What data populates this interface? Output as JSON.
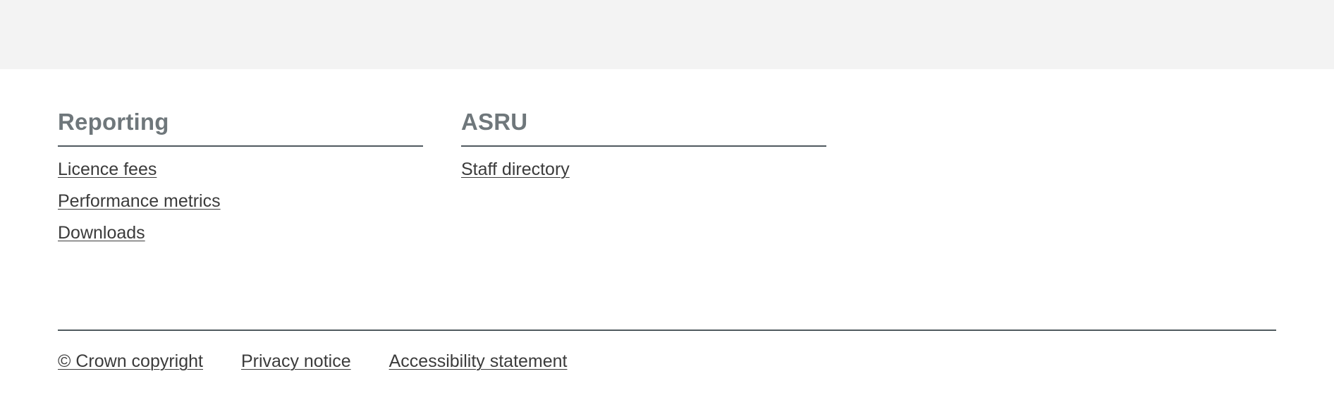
{
  "footer": {
    "columns": [
      {
        "heading": "Reporting",
        "links": [
          "Licence fees",
          "Performance metrics",
          "Downloads"
        ]
      },
      {
        "heading": "ASRU",
        "links": [
          "Staff directory"
        ]
      }
    ],
    "meta_links": [
      "© Crown copyright",
      "Privacy notice",
      "Accessibility statement"
    ]
  },
  "colors": {
    "top_band": "#f3f3f3",
    "heading": "#6f777b",
    "link": "#3b3b3b",
    "rule": "#505a5f"
  }
}
